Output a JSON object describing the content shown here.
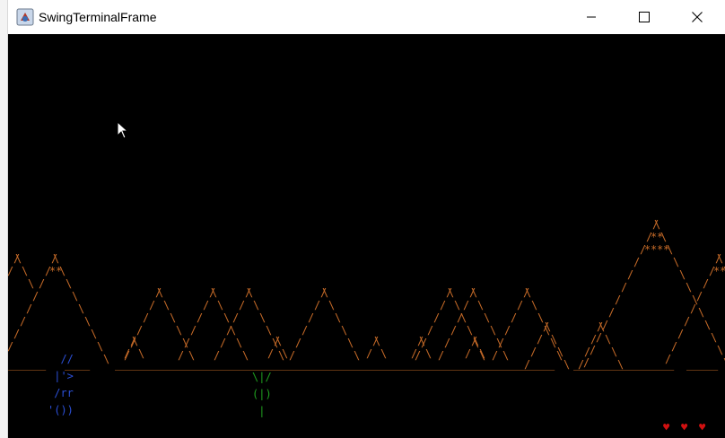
{
  "window": {
    "title": "SwingTerminalFrame",
    "controls": {
      "minimize": "minimize-icon",
      "maximize": "maximize-icon",
      "close": "close-icon"
    }
  },
  "colors": {
    "background": "#000000",
    "terrain": "#c56a28",
    "ground": "#c56a28",
    "player": "#2b4fd6",
    "plant": "#1fa01f",
    "lives": "#d01010"
  },
  "scene": {
    "ground_char": "_",
    "player_sprite": [
      "  //",
      " |'>",
      " /rr",
      "'())"
    ],
    "plant_sprite": [
      "\\|/",
      "(|)",
      " |"
    ],
    "lives": [
      "♥",
      "♥",
      "♥"
    ]
  }
}
